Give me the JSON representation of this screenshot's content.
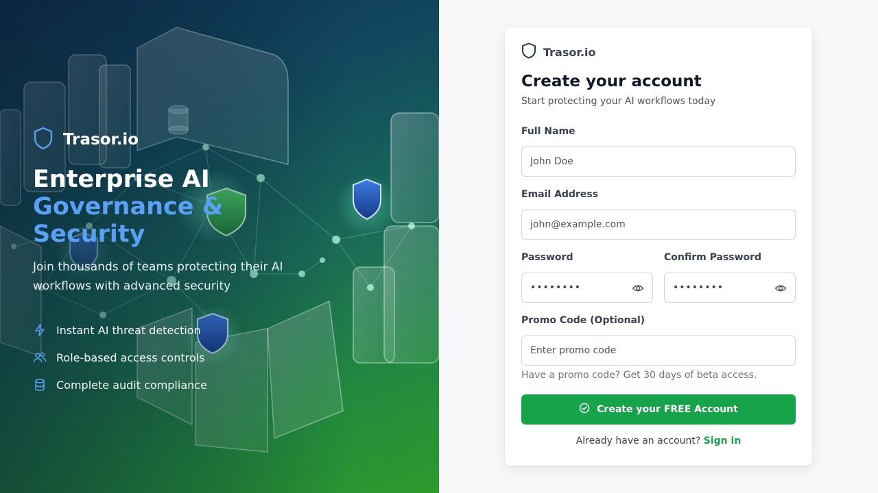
{
  "hero": {
    "brand_name": "Trasor.io",
    "headline_line1": "Enterprise AI",
    "headline_line2": "Governance & Security",
    "subtext": "Join thousands of teams protecting their AI workflows with advanced security",
    "features": [
      {
        "icon": "lightning-icon",
        "label": "Instant AI threat detection"
      },
      {
        "icon": "users-icon",
        "label": "Role-based access controls"
      },
      {
        "icon": "database-icon",
        "label": "Complete audit compliance"
      }
    ]
  },
  "form": {
    "brand_name": "Trasor.io",
    "title": "Create your account",
    "subtitle": "Start protecting your AI workflows today",
    "full_name": {
      "label": "Full Name",
      "placeholder": "John Doe"
    },
    "email": {
      "label": "Email Address",
      "placeholder": "john@example.com"
    },
    "password": {
      "label": "Password",
      "value": "••••••••"
    },
    "confirm_password": {
      "label": "Confirm Password",
      "value": "••••••••"
    },
    "promo": {
      "label": "Promo Code (Optional)",
      "placeholder": "Enter promo code"
    },
    "promo_hint": "Have a promo code? Get 30 days of beta access.",
    "submit_label": "Create your FREE Account",
    "signin_prompt": "Already have an account?",
    "signin_link": "Sign in"
  },
  "colors": {
    "accent_green": "#16a34a",
    "headline_blue": "#5aa0f5",
    "hero_gradient_start": "#0e3058",
    "hero_gradient_end": "#2e9a2c"
  }
}
